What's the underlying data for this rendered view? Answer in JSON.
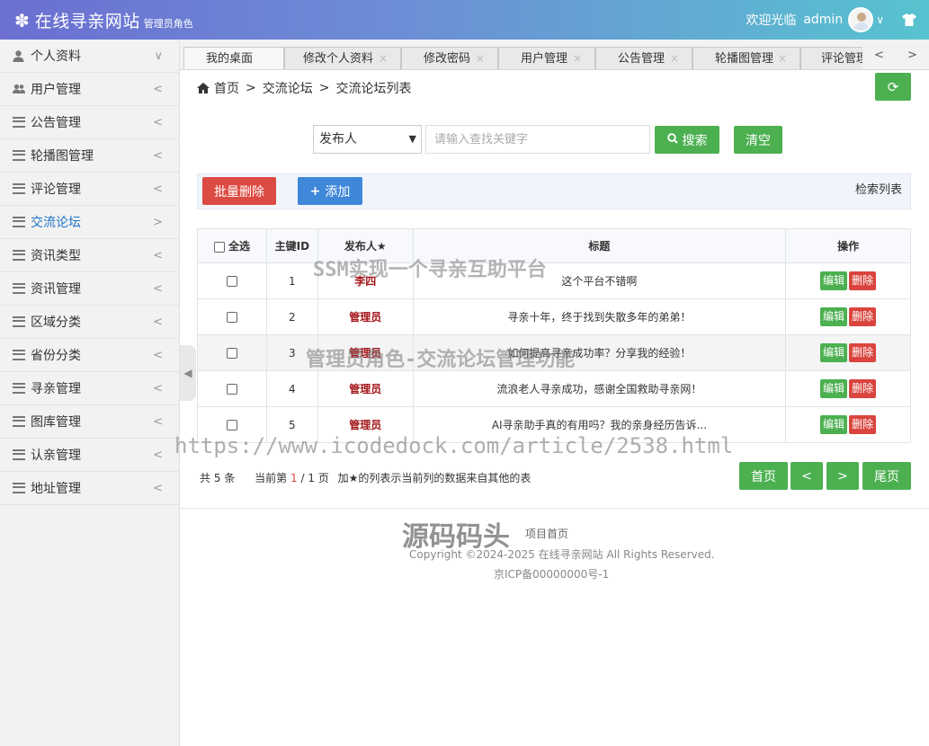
{
  "header": {
    "site_name": "在线寻亲网站",
    "role": "管理员角色",
    "welcome": "欢迎光临",
    "username": "admin"
  },
  "sidebar": {
    "items": [
      {
        "label": "个人资料",
        "icon": "user-icon",
        "arrow": "∨"
      },
      {
        "label": "用户管理",
        "icon": "users-icon",
        "arrow": "<"
      },
      {
        "label": "公告管理",
        "icon": "list-icon",
        "arrow": "<"
      },
      {
        "label": "轮播图管理",
        "icon": "list-icon",
        "arrow": "<"
      },
      {
        "label": "评论管理",
        "icon": "list-icon",
        "arrow": "<"
      },
      {
        "label": "交流论坛",
        "icon": "list-icon",
        "arrow": ">",
        "active": true
      },
      {
        "label": "资讯类型",
        "icon": "list-icon",
        "arrow": "<"
      },
      {
        "label": "资讯管理",
        "icon": "list-icon",
        "arrow": "<"
      },
      {
        "label": "区域分类",
        "icon": "list-icon",
        "arrow": "<"
      },
      {
        "label": "省份分类",
        "icon": "list-icon",
        "arrow": "<"
      },
      {
        "label": "寻亲管理",
        "icon": "list-icon",
        "arrow": "<"
      },
      {
        "label": "图库管理",
        "icon": "list-icon",
        "arrow": "<"
      },
      {
        "label": "认亲管理",
        "icon": "list-icon",
        "arrow": "<"
      },
      {
        "label": "地址管理",
        "icon": "list-icon",
        "arrow": "<"
      }
    ]
  },
  "tabs": [
    {
      "label": "我的桌面",
      "close": ""
    },
    {
      "label": "修改个人资料",
      "close": "×"
    },
    {
      "label": "修改密码",
      "close": "×"
    },
    {
      "label": "用户管理",
      "close": "×"
    },
    {
      "label": "公告管理",
      "close": "×"
    },
    {
      "label": "轮播图管理",
      "close": "×"
    },
    {
      "label": "评论管理",
      "close": ""
    }
  ],
  "tab_nav": {
    "prev": "<",
    "next": ">"
  },
  "breadcrumb": {
    "home": "首页",
    "sep": ">",
    "level1": "交流论坛",
    "level2": "交流论坛列表"
  },
  "search": {
    "field_selected": "发布人",
    "placeholder": "请输入查找关键字",
    "search_label": "搜索",
    "clear_label": "清空"
  },
  "toolbar": {
    "batch_delete": "批量删除",
    "add": "添加",
    "title": "检索列表"
  },
  "table": {
    "headers": {
      "select_all": "全选",
      "id": "主键ID",
      "author": "发布人",
      "title": "标题",
      "ops": "操作"
    },
    "edit_label": "编辑",
    "delete_label": "删除",
    "rows": [
      {
        "id": "1",
        "author": "李四",
        "title": "这个平台不错啊"
      },
      {
        "id": "2",
        "author": "管理员",
        "title": "寻亲十年，终于找到失散多年的弟弟！"
      },
      {
        "id": "3",
        "author": "管理员",
        "title": "如何提高寻亲成功率？分享我的经验！"
      },
      {
        "id": "4",
        "author": "管理员",
        "title": "流浪老人寻亲成功，感谢全国救助寻亲网！"
      },
      {
        "id": "5",
        "author": "管理员",
        "title": "AI寻亲助手真的有用吗？我的亲身经历告诉..."
      }
    ]
  },
  "pager": {
    "total_prefix": "共",
    "total": "5",
    "total_suffix": "条",
    "page_prefix": "当前第",
    "current": "1",
    "page_sep": "/",
    "pages": "1",
    "page_suffix": "页",
    "note": "加★的列表示当前列的数据来自其他的表",
    "first": "首页",
    "prev": "<",
    "next": ">",
    "last": "尾页"
  },
  "footer": {
    "home_link": "项目首页",
    "copyright": "Copyright ©2024-2025 在线寻亲网站 All Rights Reserved.",
    "icp": "京ICP备00000000号-1"
  },
  "watermarks": {
    "line1": "SSM实现一个寻亲互助平台",
    "line2": "管理员角色-交流论坛管理功能",
    "url": "https://www.icodedock.com/article/2538.html",
    "brand": "源码码头"
  },
  "colors": {
    "primary_green": "#4cb051",
    "danger_red": "#dc4b43",
    "blue": "#3f87d9",
    "active_link": "#1e74c7"
  }
}
